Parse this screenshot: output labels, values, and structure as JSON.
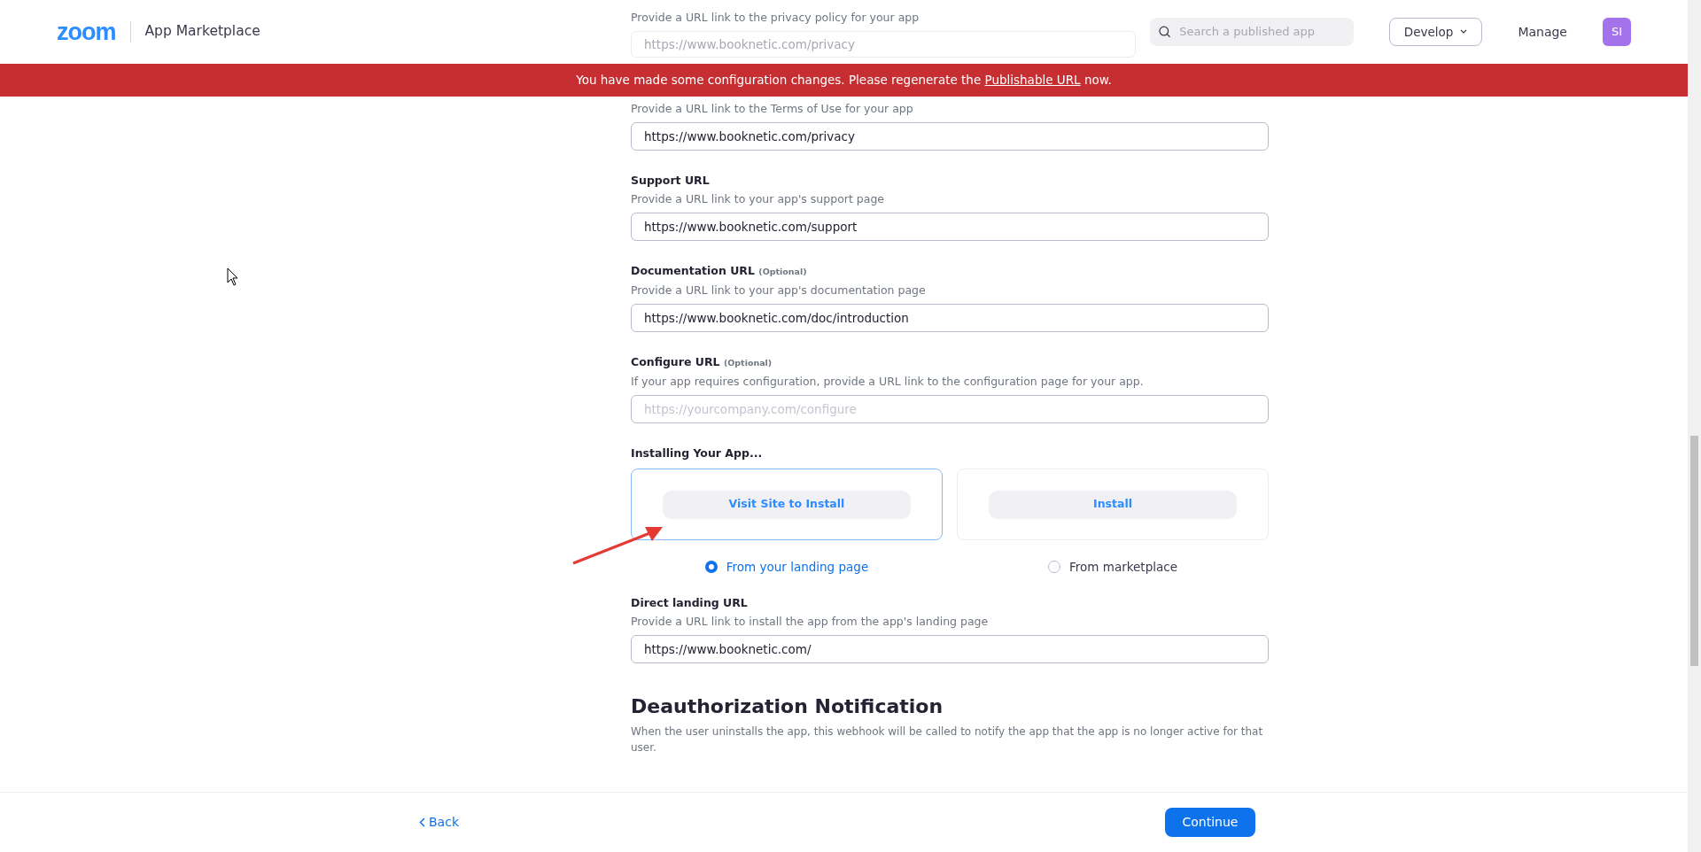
{
  "header": {
    "logo": "zoom",
    "title": "App Marketplace",
    "search": {
      "placeholder": "Search a published app"
    },
    "develop": "Develop",
    "manage": "Manage",
    "avatar": "SI"
  },
  "banner": {
    "before": "You have made some configuration changes. Please regenerate the ",
    "link": "Publishable URL",
    "after": " now."
  },
  "faded_field": {
    "description": "Provide a URL link to the privacy policy for your app",
    "value": "https://www.booknetic.com/privacy"
  },
  "fields": [
    {
      "description": "Provide a URL link to the Terms of Use for your app",
      "value": "https://www.booknetic.com/privacy"
    },
    {
      "label": "Support URL",
      "description": "Provide a URL link to your app's support page",
      "value": "https://www.booknetic.com/support"
    },
    {
      "label": "Documentation URL",
      "optional": "(Optional)",
      "description": "Provide a URL link to your app's documentation page",
      "value": "https://www.booknetic.com/doc/introduction"
    },
    {
      "label": "Configure URL",
      "optional": "(Optional)",
      "description": "If your app requires configuration, provide a URL link to the configuration page for your app.",
      "placeholder": "https://yourcompany.com/configure"
    }
  ],
  "install": {
    "title": "Installing Your App...",
    "options": [
      {
        "button": "Visit Site to Install",
        "radio_label": "From your landing page",
        "selected": true
      },
      {
        "button": "Install",
        "radio_label": "From marketplace",
        "selected": false
      }
    ]
  },
  "landing": {
    "label": "Direct landing URL",
    "description": "Provide a URL link to install the app from the app's landing page",
    "value": "https://www.booknetic.com/"
  },
  "deauth": {
    "title": "Deauthorization Notification",
    "description": "When the user uninstalls the app, this webhook will be called to notify the app that the app is no longer active for that user."
  },
  "footer": {
    "back": "Back",
    "continue": "Continue"
  }
}
